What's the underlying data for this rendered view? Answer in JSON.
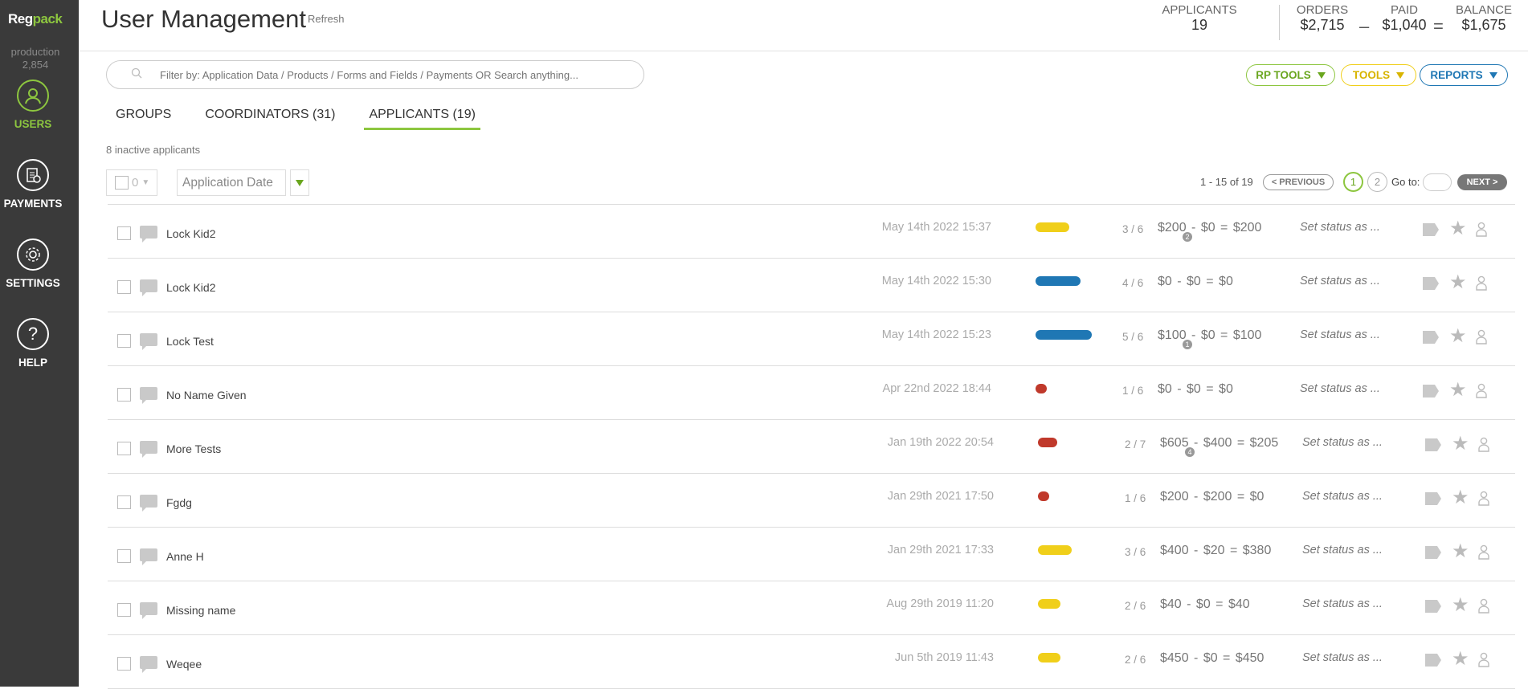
{
  "brand": {
    "logo_text_a": "Reg",
    "logo_text_b": "pack"
  },
  "env": {
    "name": "production",
    "number": "2,854"
  },
  "nav": [
    {
      "label": "USERS",
      "icon": "user-icon",
      "active": true
    },
    {
      "label": "PAYMENTS",
      "icon": "payments-icon",
      "active": false
    },
    {
      "label": "SETTINGS",
      "icon": "gear-icon",
      "active": false
    },
    {
      "label": "HELP",
      "icon": "help-icon",
      "active": false
    }
  ],
  "header": {
    "title": "User Management",
    "refresh": "Refresh"
  },
  "stats": {
    "applicants_label": "APPLICANTS",
    "applicants_value": "19",
    "orders_label": "ORDERS",
    "orders_value": "$2,715",
    "paid_label": "PAID",
    "paid_value": "$1,040",
    "balance_label": "BALANCE",
    "balance_value": "$1,675",
    "minus": "–",
    "equals": "="
  },
  "search": {
    "placeholder": "Filter by: Application Data / Products / Forms and Fields / Payments OR Search anything..."
  },
  "tools": {
    "rp_tools": "RP TOOLS",
    "tools": "TOOLS",
    "reports": "REPORTS"
  },
  "tabs": [
    {
      "label": "GROUPS",
      "active": false
    },
    {
      "label": "COORDINATORS (31)",
      "active": false
    },
    {
      "label": "APPLICANTS (19)",
      "active": true
    }
  ],
  "inactive_text": "8 inactive applicants",
  "bulk": {
    "count": "0"
  },
  "sort": {
    "label": "Application Date"
  },
  "pager": {
    "info": "1 - 15 of 19",
    "previous": "< PREVIOUS",
    "page1": "1",
    "page2": "2",
    "goto": "Go to:",
    "next": "NEXT >"
  },
  "colors": {
    "green": "#8dc63f",
    "yellow": "#f0cf1a",
    "blue": "#1f77b4",
    "red": "#c0392b",
    "sidebar": "#3a3a3a"
  },
  "rows": [
    {
      "name": "Lock Kid2",
      "date": "May 14th 2022 15:37",
      "progress": "3 / 6",
      "bar_color": "yellow",
      "bar_fraction": 0.5,
      "order": "$200",
      "badge": "2",
      "paid": "$0",
      "balance": "$200",
      "status": "Set status as ..."
    },
    {
      "name": "Lock Kid2",
      "date": "May 14th 2022 15:30",
      "progress": "4 / 6",
      "bar_color": "blue",
      "bar_fraction": 0.667,
      "order": "$0",
      "badge": "",
      "paid": "$0",
      "balance": "$0",
      "status": "Set status as ..."
    },
    {
      "name": "Lock Test",
      "date": "May 14th 2022 15:23",
      "progress": "5 / 6",
      "bar_color": "blue",
      "bar_fraction": 0.833,
      "order": "$100",
      "badge": "1",
      "paid": "$0",
      "balance": "$100",
      "status": "Set status as ..."
    },
    {
      "name": "No Name Given",
      "date": "Apr 22nd 2022 18:44",
      "progress": "1 / 6",
      "bar_color": "red",
      "bar_fraction": 0.167,
      "order": "$0",
      "badge": "",
      "paid": "$0",
      "balance": "$0",
      "status": "Set status as ..."
    },
    {
      "name": "More Tests",
      "date": "Jan 19th 2022 20:54",
      "progress": "2 / 7",
      "bar_color": "red",
      "bar_fraction": 0.286,
      "order": "$605",
      "badge": "4",
      "paid": "$400",
      "balance": "$205",
      "status": "Set status as ..."
    },
    {
      "name": "Fgdg",
      "date": "Jan 29th 2021 17:50",
      "progress": "1 / 6",
      "bar_color": "red",
      "bar_fraction": 0.167,
      "order": "$200",
      "badge": "",
      "paid": "$200",
      "balance": "$0",
      "status": "Set status as ..."
    },
    {
      "name": "Anne H",
      "date": "Jan 29th 2021 17:33",
      "progress": "3 / 6",
      "bar_color": "yellow",
      "bar_fraction": 0.5,
      "order": "$400",
      "badge": "",
      "paid": "$20",
      "balance": "$380",
      "status": "Set status as ..."
    },
    {
      "name": "Missing name",
      "date": "Aug 29th 2019 11:20",
      "progress": "2 / 6",
      "bar_color": "yellow",
      "bar_fraction": 0.333,
      "order": "$40",
      "badge": "",
      "paid": "$0",
      "balance": "$40",
      "status": "Set status as ..."
    },
    {
      "name": "Weqee",
      "date": "Jun 5th 2019 11:43",
      "progress": "2 / 6",
      "bar_color": "yellow",
      "bar_fraction": 0.333,
      "order": "$450",
      "badge": "",
      "paid": "$0",
      "balance": "$450",
      "status": "Set status as ..."
    }
  ]
}
